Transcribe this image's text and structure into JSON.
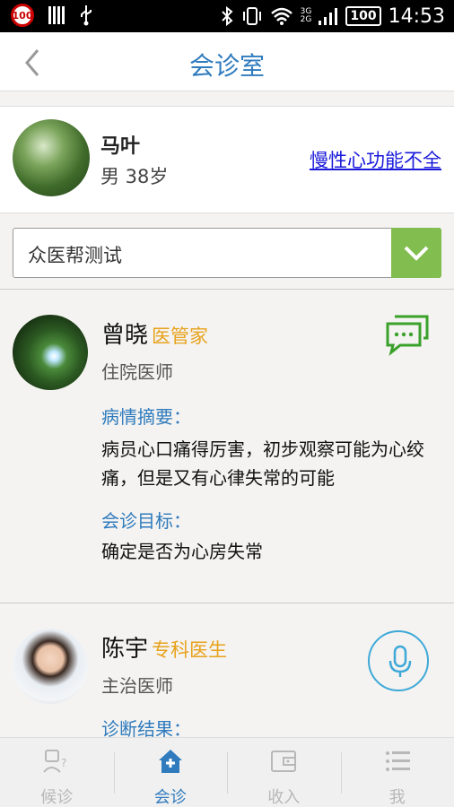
{
  "status_bar": {
    "badge": "100",
    "network_3g": "3G",
    "network_2g": "2G",
    "battery": "100",
    "time": "14:53"
  },
  "header": {
    "title": "会诊室",
    "back_icon": "chevron-left-icon"
  },
  "patient": {
    "name": "马叶",
    "info": "男 38岁",
    "diagnosis_link": "慢性心功能不全"
  },
  "group_selector": {
    "value": "众医帮测试",
    "icon": "chevron-down-icon"
  },
  "doctors": [
    {
      "name": "曾晓",
      "role": "医管家",
      "title": "住院医师",
      "action_icon": "chat-icon",
      "summary_label": "病情摘要：",
      "summary_text": "病员心口痛得厉害，初步观察可能为心绞痛，但是又有心律失常的可能",
      "goal_label": "会诊目标：",
      "goal_text": "确定是否为心房失常"
    },
    {
      "name": "陈宇",
      "role": "专科医生",
      "title": "主治医师",
      "action_icon": "microphone-icon",
      "result_label": "诊断结果："
    }
  ],
  "tabs": [
    {
      "label": "候诊",
      "icon": "waiting-doctor-icon",
      "active": false
    },
    {
      "label": "会诊",
      "icon": "consult-home-icon",
      "active": true
    },
    {
      "label": "收入",
      "icon": "wallet-icon",
      "active": false
    },
    {
      "label": "我",
      "icon": "list-menu-icon",
      "active": false
    }
  ],
  "colors": {
    "accent_blue": "#2f7bbd",
    "role_orange": "#e8a21c",
    "selector_green": "#82bd4f",
    "chat_green": "#3aa12a",
    "mic_blue": "#3ea9d8",
    "link_blue": "#1a1adb"
  }
}
